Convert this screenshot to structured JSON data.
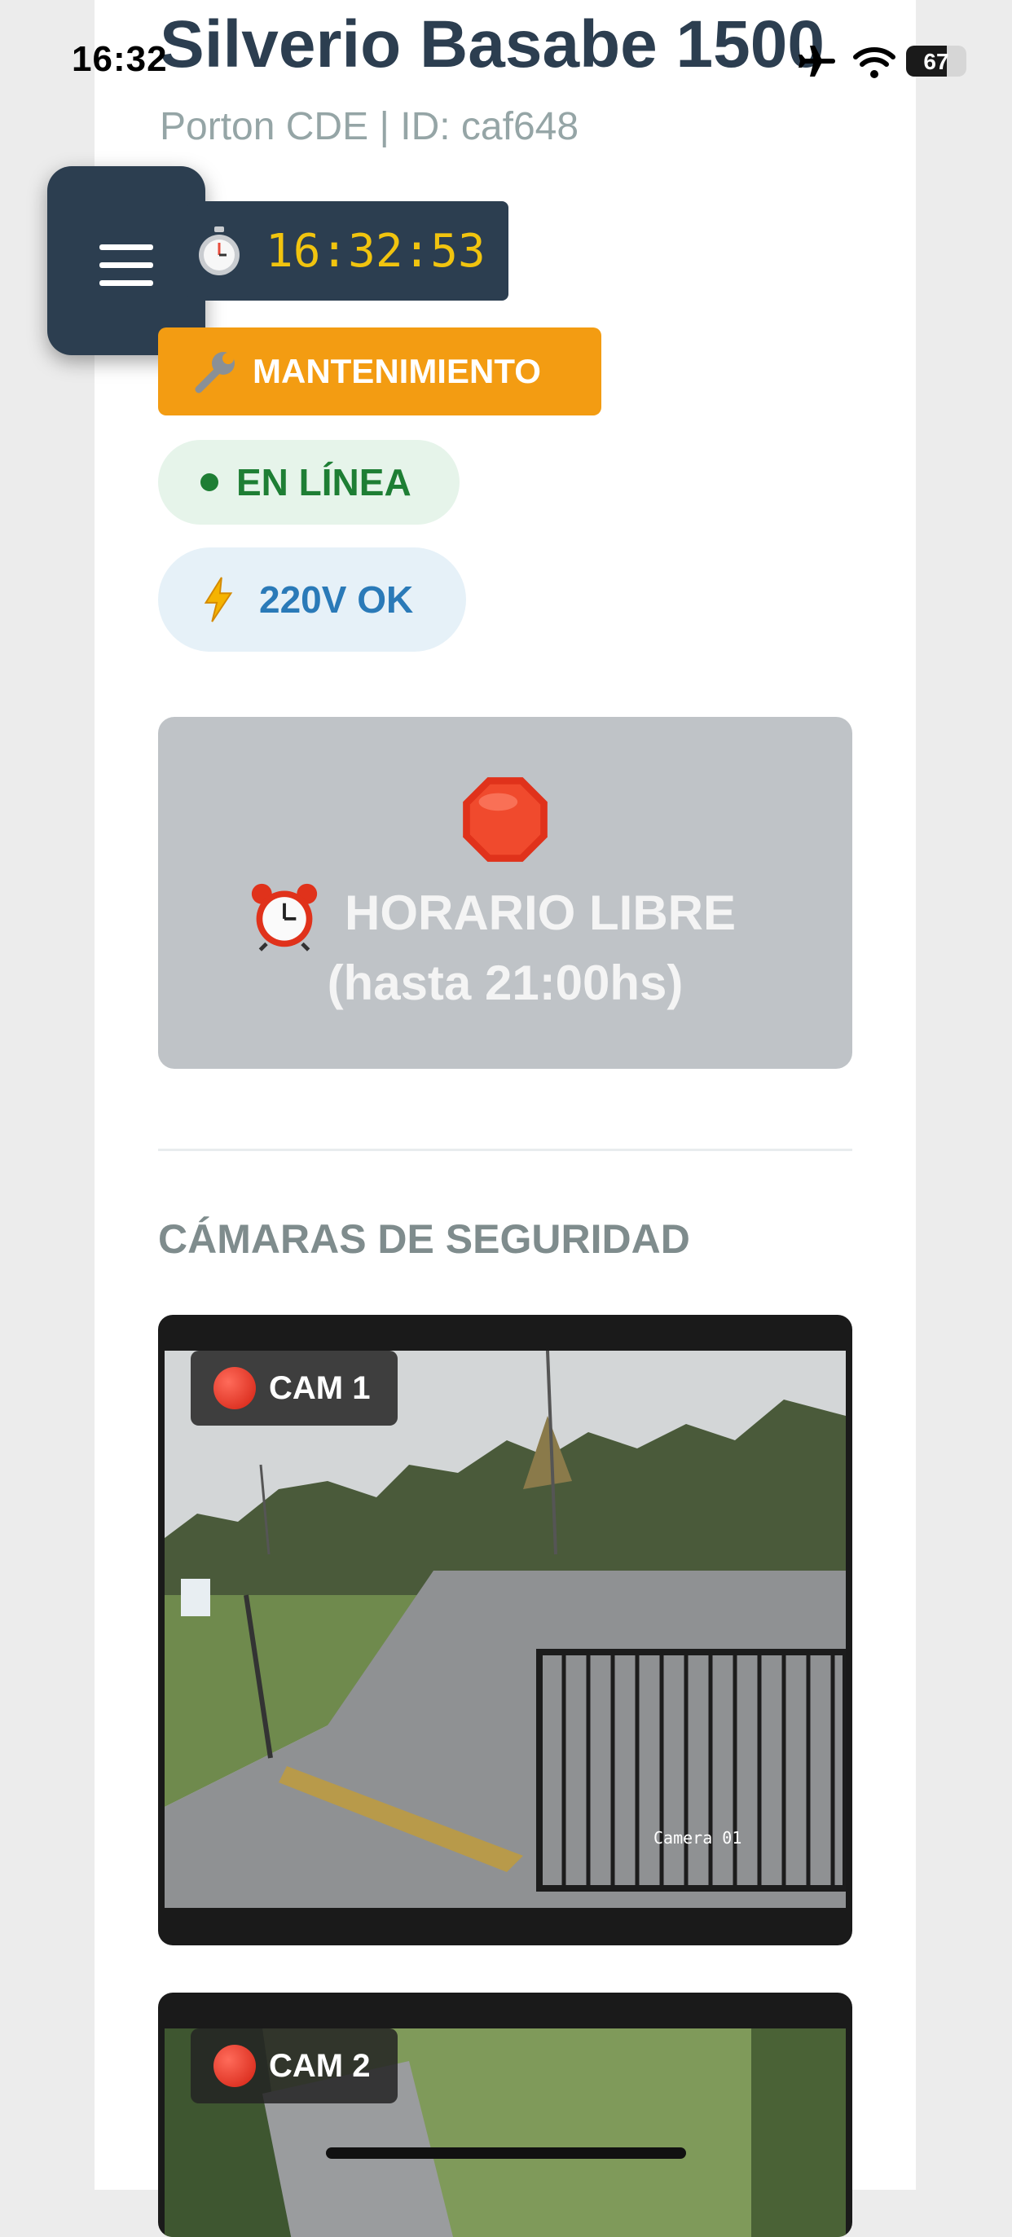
{
  "status_bar": {
    "time": "16:32",
    "battery": "67",
    "icons": [
      "airplane-icon",
      "wifi-icon",
      "battery-icon"
    ]
  },
  "header": {
    "title": "Silverio Basabe 1500",
    "subtitle": "Porton CDE | ID: caf648"
  },
  "menu": {
    "icon": "hamburger-icon"
  },
  "clock": {
    "icon": "stopwatch-icon",
    "time": "16:32:53"
  },
  "badges": {
    "maintenance": {
      "icon": "wrench-icon",
      "label": "MANTENIMIENTO",
      "color": "#f39c12"
    },
    "online": {
      "icon": "dot-icon",
      "label": "EN LÍNEA",
      "color": "#1e7e34"
    },
    "power": {
      "icon": "lightning-icon",
      "label": "220V OK",
      "color": "#2a7ab8"
    }
  },
  "schedule": {
    "icon": "stop-sign-icon",
    "line1": "HORARIO LIBRE",
    "line2": "(hasta 21:00hs)",
    "line1_icon": "alarm-clock-icon"
  },
  "cameras": {
    "section_title": "CÁMARAS DE SEGURIDAD",
    "items": [
      {
        "label": "CAM 1",
        "caption": "Camera 01"
      },
      {
        "label": "CAM 2"
      }
    ]
  }
}
